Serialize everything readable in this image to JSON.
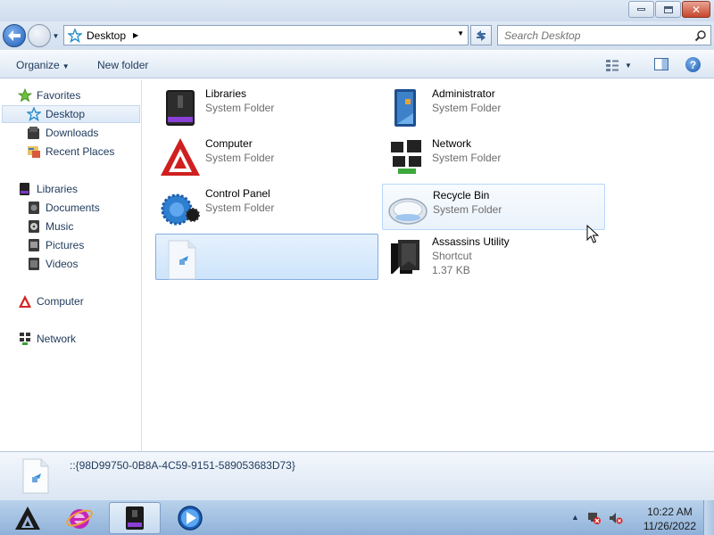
{
  "window": {
    "caption_buttons": {
      "minimize": "minimize-icon",
      "maximize": "maximize-icon",
      "close": "close-icon"
    }
  },
  "navigation": {
    "address": "Desktop",
    "search_placeholder": "Search Desktop"
  },
  "toolbar": {
    "organize_label": "Organize",
    "new_folder_label": "New folder"
  },
  "sidebar": {
    "favorites": {
      "label": "Favorites",
      "items": [
        "Desktop",
        "Downloads",
        "Recent Places"
      ]
    },
    "libraries": {
      "label": "Libraries",
      "items": [
        "Documents",
        "Music",
        "Pictures",
        "Videos"
      ]
    },
    "computer": "Computer",
    "network": "Network"
  },
  "items": [
    {
      "name": "Libraries",
      "type": "System Folder"
    },
    {
      "name": "Administrator",
      "type": "System Folder"
    },
    {
      "name": "Computer",
      "type": "System Folder"
    },
    {
      "name": "Network",
      "type": "System Folder"
    },
    {
      "name": "Control Panel",
      "type": "System Folder"
    },
    {
      "name": "Recycle Bin",
      "type": "System Folder"
    },
    {
      "name": "",
      "type": ""
    },
    {
      "name": "Assassins Utility",
      "type": "Shortcut",
      "size": "1.37 KB"
    }
  ],
  "details": {
    "selected_name": "::{98D99750-0B8A-4C59-9151-589053683D73}"
  },
  "taskbar": {
    "time": "10:22 AM",
    "date": "11/26/2022"
  },
  "colors": {
    "accent": "#1e395b",
    "selection": "#cde4fb",
    "secondary_text": "#6d6d6d"
  }
}
